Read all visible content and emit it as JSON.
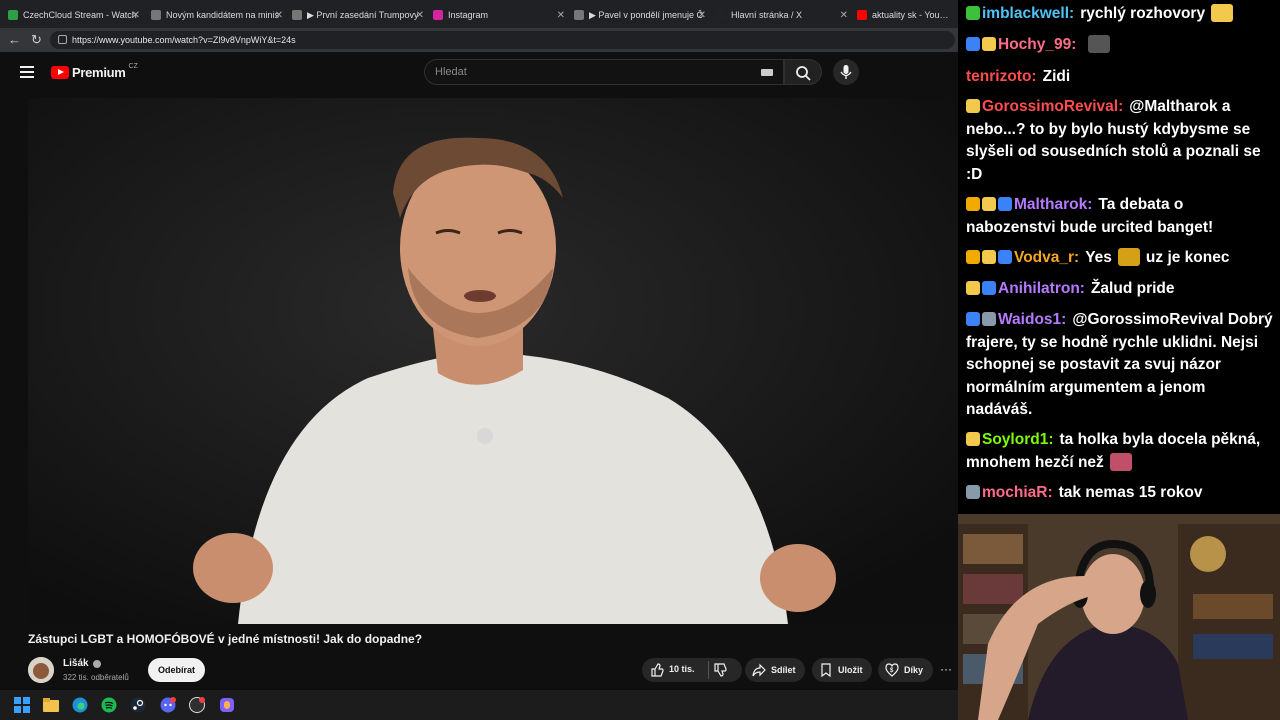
{
  "browser": {
    "tabs": [
      {
        "label": "CzechCloud Stream - Watch",
        "favicon_color": "#2ea043"
      },
      {
        "label": "Novým kandidátem na minis",
        "favicon_color": "#777777"
      },
      {
        "label": "▶ První zasedání Trumpovy",
        "favicon_color": "#777777"
      },
      {
        "label": "Instagram",
        "favicon_color": "#d6249f"
      },
      {
        "label": "▶ Pavel v pondělí jmenuje Č",
        "favicon_color": "#777777"
      },
      {
        "label": "Hlavní stránka / X",
        "favicon_color": "#222222"
      },
      {
        "label": "aktuality sk - YouTube",
        "favicon_color": "#ff0000"
      }
    ],
    "url": "https://www.youtube.com/watch?v=Zl9v8VnpWiY&t=24s"
  },
  "youtube": {
    "logo_text": "Premium",
    "region": "CZ",
    "search_placeholder": "Hledat",
    "video_title": "Zástupci LGBT a HOMOFÓBOVÉ v jedné místnosti! Jak do dopadne?",
    "channel_name": "Lišák",
    "subscribers": "322 tis. odběratelů",
    "subscribe_label": "Odebírat",
    "likes": "10 tis.",
    "share_label": "Sdílet",
    "save_label": "Uložit",
    "thanks_label": "Díky",
    "more_label": "···"
  },
  "chat": {
    "messages": [
      {
        "user": "imblackwell:",
        "color": "#4fc3f7",
        "badges": [
          "#3cc13c"
        ],
        "text": "rychlý rozhovory",
        "emote": "#f2c94c"
      },
      {
        "user": "Hochy_99:",
        "color": "#ff6b8a",
        "badges": [
          "#3b82f6",
          "#f2c94c"
        ],
        "text": "",
        "emote": "#555555"
      },
      {
        "user": "tenrizoto:",
        "color": "#ff4d4d",
        "badges": [],
        "text": "Zidi",
        "emote": ""
      },
      {
        "user": "GorossimoRevival:",
        "color": "#ff4d4d",
        "badges": [
          "#f2c94c"
        ],
        "text": "@Maltharok a nebo...? to by bylo hustý kdybysme se slyšeli od sousedních stolů a poznali se :D",
        "emote": ""
      },
      {
        "user": "Maltharok:",
        "color": "#b57aff",
        "badges": [
          "#f2a900",
          "#f2c94c",
          "#3b82f6"
        ],
        "text": "Ta debata o nabozenstvi bude urcited banget!",
        "emote": ""
      },
      {
        "user": "Vodva_r:",
        "color": "#f5a623",
        "badges": [
          "#f2a900",
          "#f2c94c",
          "#3b82f6"
        ],
        "text": "Yes",
        "emote": "#d4a017",
        "after": "uz je konec"
      },
      {
        "user": "Anihilatron:",
        "color": "#b57aff",
        "badges": [
          "#f2c94c",
          "#3b82f6"
        ],
        "text": "Žalud pride",
        "emote": ""
      },
      {
        "user": "Waidos1:",
        "color": "#b57aff",
        "badges": [
          "#3b82f6",
          "#8899aa"
        ],
        "text": "@GorossimoRevival Dobrý frajere, ty se hodně rychle uklidni. Nejsi schopnej se postavit za svuj názor normálním argumentem a jenom nadáváš.",
        "emote": ""
      },
      {
        "user": "Soylord1:",
        "color": "#7cfc00",
        "badges": [
          "#f2c94c"
        ],
        "text": "ta holka byla docela pěkná, mnohem hezčí než",
        "emote": "#c0506a"
      },
      {
        "user": "mochiaR:",
        "color": "#ff6b8a",
        "badges": [
          "#8899aa"
        ],
        "text": "tak nemas 15 rokov",
        "emote": ""
      }
    ]
  }
}
